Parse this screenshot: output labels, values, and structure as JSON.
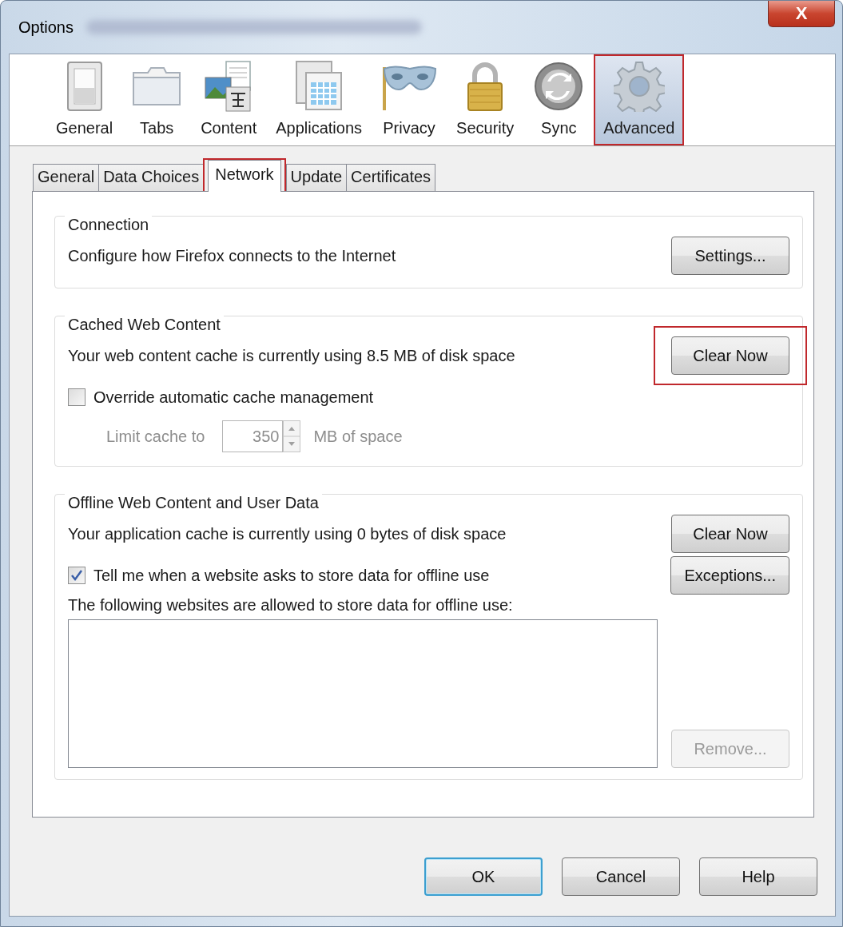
{
  "window": {
    "title": "Options",
    "close_label": "X"
  },
  "categories": [
    {
      "label": "General",
      "selected": false,
      "highlighted": false
    },
    {
      "label": "Tabs",
      "selected": false,
      "highlighted": false
    },
    {
      "label": "Content",
      "selected": false,
      "highlighted": false
    },
    {
      "label": "Applications",
      "selected": false,
      "highlighted": false
    },
    {
      "label": "Privacy",
      "selected": false,
      "highlighted": false
    },
    {
      "label": "Security",
      "selected": false,
      "highlighted": false
    },
    {
      "label": "Sync",
      "selected": false,
      "highlighted": false
    },
    {
      "label": "Advanced",
      "selected": true,
      "highlighted": true
    }
  ],
  "tabs": [
    {
      "label": "General",
      "selected": false,
      "highlighted": false
    },
    {
      "label": "Data Choices",
      "selected": false,
      "highlighted": false
    },
    {
      "label": "Network",
      "selected": true,
      "highlighted": true
    },
    {
      "label": "Update",
      "selected": false,
      "highlighted": false
    },
    {
      "label": "Certificates",
      "selected": false,
      "highlighted": false
    }
  ],
  "groups": [
    {
      "title": "Connection",
      "items": [
        {
          "kind": "text_button",
          "text": "Configure how Firefox connects to the Internet",
          "button": {
            "label": "Settings...",
            "disabled": false
          }
        }
      ]
    },
    {
      "title": "Cached Web Content",
      "items": [
        {
          "kind": "text_button",
          "text": "Your web content cache is currently using 8.5 MB of disk space",
          "button": {
            "label": "Clear Now",
            "highlighted": true,
            "disabled": false
          }
        },
        {
          "kind": "checkbox",
          "label": "Override automatic cache management",
          "checked": false
        },
        {
          "kind": "limit",
          "label": "Limit cache to",
          "value": "350",
          "unit": "MB of space",
          "disabled": true
        }
      ]
    },
    {
      "title": "Offline Web Content and User Data",
      "items": [
        {
          "kind": "text_button",
          "text": "Your application cache is currently using 0 bytes of disk space",
          "button": {
            "label": "Clear Now",
            "disabled": false
          }
        },
        {
          "kind": "checkbox",
          "label": "Tell me when a website asks to store data for offline use",
          "checked": true,
          "button": {
            "label": "Exceptions...",
            "disabled": false
          }
        },
        {
          "kind": "label",
          "text": "The following websites are allowed to store data for offline use:"
        },
        {
          "kind": "list",
          "button": {
            "label": "Remove...",
            "disabled": true
          }
        }
      ]
    }
  ],
  "buttons": [
    {
      "label": "OK",
      "default": true
    },
    {
      "label": "Cancel",
      "default": false
    },
    {
      "label": "Help",
      "default": false
    }
  ]
}
